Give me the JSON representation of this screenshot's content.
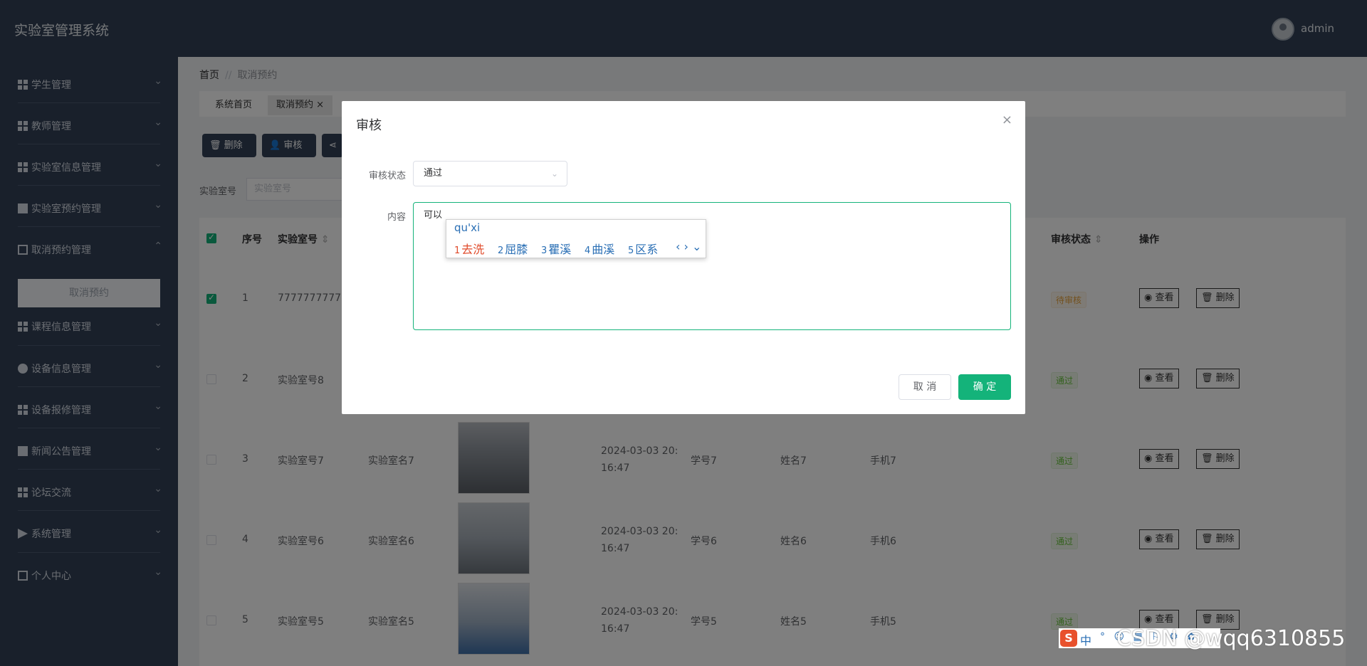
{
  "app": {
    "title": "实验室管理系统",
    "username": "admin"
  },
  "sidebar": {
    "items": [
      {
        "label": "学生管理",
        "icon": "grid-icon",
        "arrow": "⌄"
      },
      {
        "label": "教师管理",
        "icon": "grid-icon",
        "arrow": "⌄"
      },
      {
        "label": "实验室信息管理",
        "icon": "grid-icon",
        "arrow": "⌄"
      },
      {
        "label": "实验室预约管理",
        "icon": "checkbox-icon",
        "arrow": "⌄"
      },
      {
        "label": "取消预约管理",
        "icon": "document-icon",
        "arrow": "⌃"
      },
      {
        "label": "课程信息管理",
        "icon": "grid-icon",
        "arrow": "⌄"
      },
      {
        "label": "设备信息管理",
        "icon": "bulb-icon",
        "arrow": "⌄"
      },
      {
        "label": "设备报修管理",
        "icon": "grid-icon",
        "arrow": "⌄"
      },
      {
        "label": "新闻公告管理",
        "icon": "news-icon",
        "arrow": "⌄"
      },
      {
        "label": "论坛交流",
        "icon": "grid-icon",
        "arrow": "⌄"
      },
      {
        "label": "系统管理",
        "icon": "send-icon",
        "arrow": "⌄"
      },
      {
        "label": "个人中心",
        "icon": "card-icon",
        "arrow": "⌄"
      }
    ],
    "sub_item": "取消预约"
  },
  "breadcrumb": {
    "home": "首页",
    "sep": "//",
    "current": "取消预约"
  },
  "tags": {
    "home": "系统首页",
    "active": "取消预约",
    "close": "×"
  },
  "toolbar": {
    "delete": "删除",
    "audit": "审核"
  },
  "search": {
    "label": "实验室号",
    "placeholder": "实验室号"
  },
  "table": {
    "headers": {
      "index": "序号",
      "lab_no": "实验室号",
      "audit_status": "审核状态",
      "actions": "操作"
    },
    "sort_icon": "⇕",
    "view_label": "查看",
    "delete_label": "删除",
    "rows": [
      {
        "index": "1",
        "lab_no": "7777777777",
        "lab_name": "",
        "time_line1": "",
        "time_line2": "",
        "student_no": "",
        "name": "",
        "phone": "",
        "status": "待审核"
      },
      {
        "index": "2",
        "lab_no": "实验室号8",
        "lab_name": "",
        "time_line1": "",
        "time_line2": "",
        "student_no": "",
        "name": "",
        "phone": "",
        "status": "通过"
      },
      {
        "index": "3",
        "lab_no": "实验室号7",
        "lab_name": "实验室名7",
        "time_line1": "2024-03-03 20:",
        "time_line2": "16:47",
        "student_no": "学号7",
        "name": "姓名7",
        "phone": "手机7",
        "status": "通过"
      },
      {
        "index": "4",
        "lab_no": "实验室号6",
        "lab_name": "实验室名6",
        "time_line1": "2024-03-03 20:",
        "time_line2": "16:47",
        "student_no": "学号6",
        "name": "姓名6",
        "phone": "手机6",
        "status": "通过"
      },
      {
        "index": "5",
        "lab_no": "实验室号5",
        "lab_name": "实验室名5",
        "time_line1": "2024-03-03 20:",
        "time_line2": "16:47",
        "student_no": "学号5",
        "name": "姓名5",
        "phone": "手机5",
        "status": "通过"
      }
    ]
  },
  "dialog": {
    "title": "审核",
    "close": "×",
    "status_label": "审核状态",
    "status_value": "通过",
    "content_label": "内容",
    "content_value": "可以",
    "cancel": "取 消",
    "confirm": "确 定"
  },
  "ime": {
    "input": "qu'xi",
    "candidates": [
      {
        "n": "1",
        "text": "去洗"
      },
      {
        "n": "2",
        "text": "屈膝"
      },
      {
        "n": "3",
        "text": "瞿溪"
      },
      {
        "n": "4",
        "text": "曲溪"
      },
      {
        "n": "5",
        "text": "区系"
      }
    ],
    "nav": "‹ › ⌄",
    "bar_logo": "S",
    "bar_lang": "中",
    "bar_tools": "° ☺ ▦ ⚐ ⚙ ✿"
  },
  "watermark": "CSDN @wqq6310855",
  "colors": {
    "sidebar": "#324157",
    "accent": "#14b37a",
    "pending": "#e6a23c",
    "pass": "#67c23a"
  }
}
